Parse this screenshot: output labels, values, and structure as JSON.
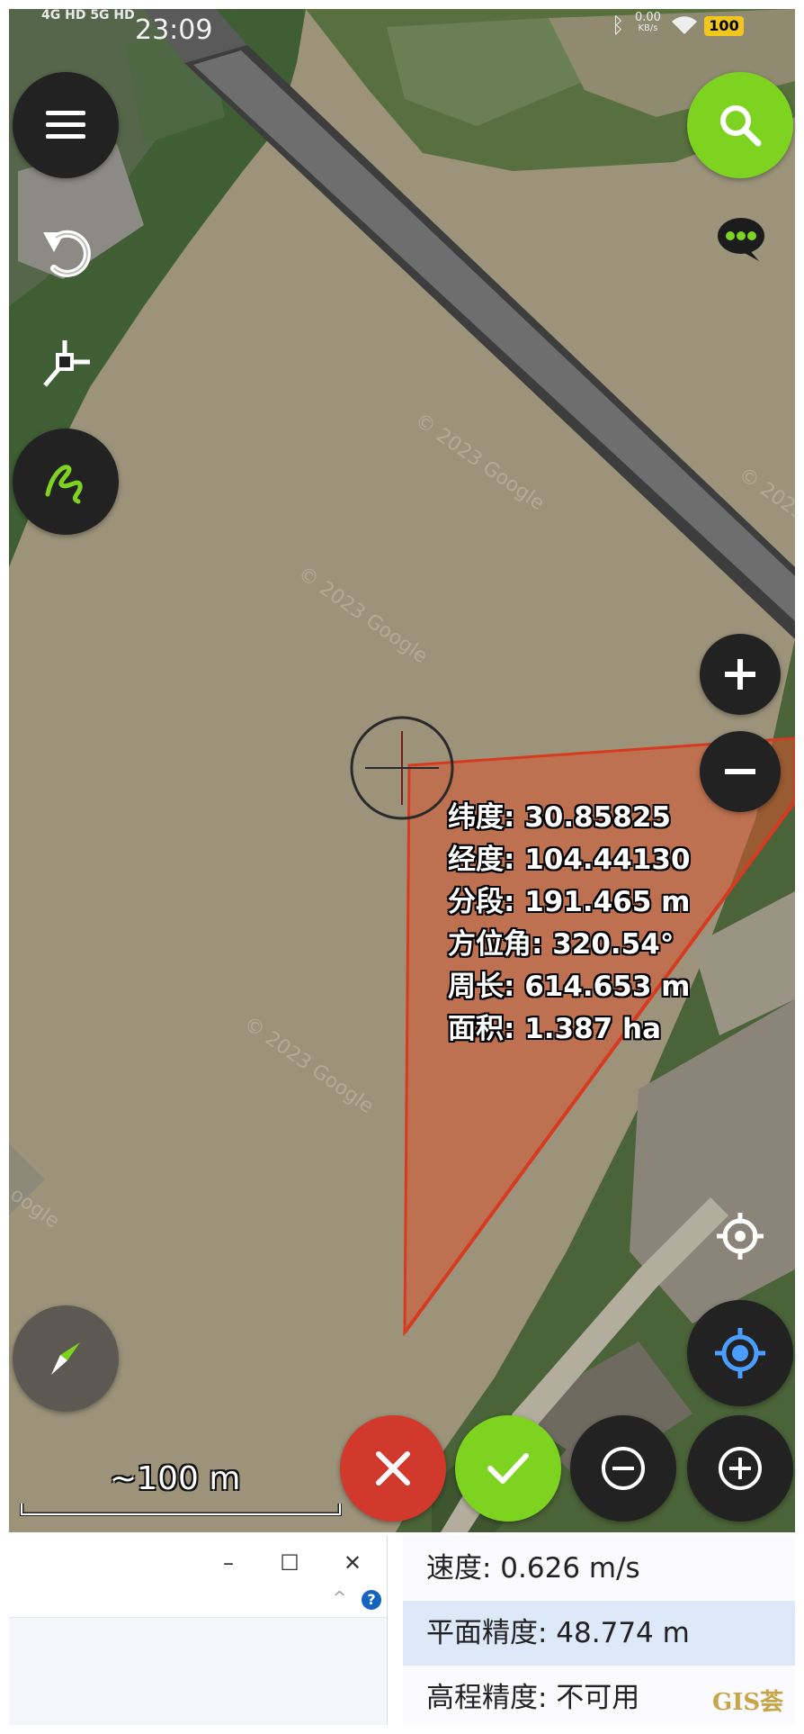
{
  "status_bar": {
    "network": "4G HD 5G HD",
    "time": "23:09",
    "speed_value": "0.00",
    "speed_unit": "KB/s",
    "battery": "100"
  },
  "map": {
    "watermark_text": "© 2023 Google",
    "measure_info": {
      "latitude": "纬度: 30.85825",
      "longitude": "经度: 104.44130",
      "segment": "分段: 191.465 m",
      "azimuth": "方位角: 320.54°",
      "perimeter": "周长: 614.653 m",
      "area": "面积: 1.387 ha"
    },
    "scale_label": "~100 m",
    "polygon_color": "#d9552e"
  },
  "controls": {
    "menu_icon": "menu-icon",
    "search_icon": "search-icon",
    "chat_icon": "chat-icon",
    "undo_icon": "undo-icon",
    "add_vertex_icon": "add-vertex-icon",
    "freehand_icon": "freehand-icon",
    "zoom_in_icon": "plus-icon",
    "zoom_out_icon": "minus-icon",
    "crosshair_icon": "crosshair-icon",
    "my_location_icon": "my-location-icon",
    "compass_icon": "compass-icon",
    "cancel_icon": "close-icon",
    "confirm_icon": "check-icon",
    "remove_point_icon": "minus-circle-icon",
    "add_point_icon": "plus-circle-icon"
  },
  "stats_panel": {
    "speed": "速度: 0.626 m/s",
    "horizontal_accuracy": "平面精度: 48.774 m",
    "vertical_accuracy": "高程精度: 不可用"
  },
  "window_panel": {
    "minimize": "–",
    "maximize": "☐",
    "close": "✕",
    "help": "?",
    "caret": "^"
  },
  "watermark": "GIS荟",
  "colors": {
    "accent_green": "#7ed321",
    "cancel_red": "#d0392b",
    "fab_dark": "#222222",
    "location_blue": "#4a9eff"
  }
}
